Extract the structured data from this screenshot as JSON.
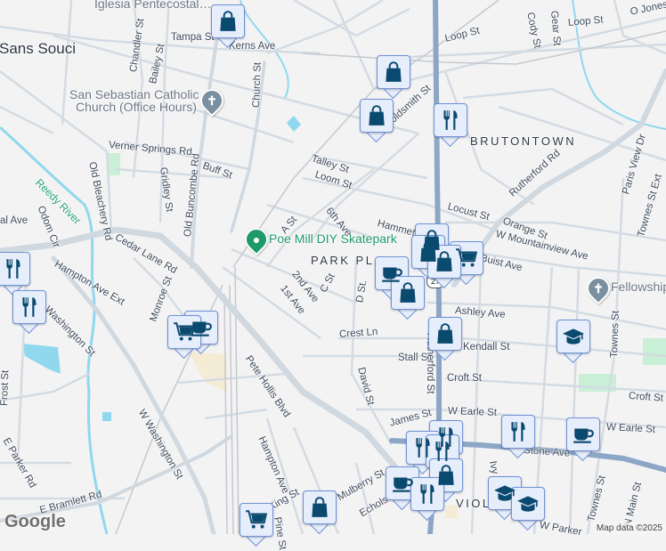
{
  "map": {
    "neighborhoods": [
      "Sans Souci",
      "BRUTONTOWN",
      "PARK PLACE",
      "VIOLA"
    ],
    "places": {
      "church1": "Iglesia Pentecostal…",
      "church2_line1": "San Sebastian Catholic",
      "church2_line2": "Church (Office Hours)",
      "skatepark": "Poe Mill DIY Skatepark",
      "fellowship": "Fellowship",
      "river": "Reedy River"
    },
    "streets": [
      "Tampa St",
      "Kerns Ave",
      "Chandler St",
      "Bailey St",
      "Church St",
      "Verner Springs Rd",
      "Buff St",
      "Old Bleachery Rd",
      "Gridley St",
      "Old Buncombe Rd",
      "Odom Cir",
      "al Ave",
      "Cedar Lane Rd",
      "A St",
      "6th Ave",
      "Talley St",
      "Loom St",
      "Hammett St",
      "2nd Ave",
      "1st Ave",
      "C St",
      "D St.",
      "oldsmith St",
      "Loop St",
      "Loop St",
      "O Jones",
      "Cody St",
      "Rutherford Rd",
      "Paris View Dr",
      "Townes St Ext",
      "Locust St",
      "Orange St",
      "W Mountainview Ave",
      "Buist Ave",
      "Ashley Ave",
      "Crest Ln",
      "Kendall St",
      "Stall St",
      "Rutherford St",
      "Croft St",
      "Croft St",
      "David St",
      "Townes St",
      "James St",
      "W Earle St",
      "W Earle St",
      "Stone Ave",
      "Ivy St",
      "Mulberry St",
      "Echols St",
      "W Parker",
      "Townes St",
      "N Main St",
      "Hampton Ave Ext",
      "Monroe St",
      "Washington St",
      "Frost St",
      "W Washington St",
      "Pete Hollis Blvd",
      "E Parker Rd",
      "Hampton Ave",
      "E Bramlett Rd",
      "King St",
      "Pine St",
      "Gear St"
    ],
    "route_shield": "27",
    "attribution": "Map data ©2025",
    "logo": "Google"
  },
  "colors": {
    "highway": "#8ca6c6",
    "marker_bg": "#e6edfb",
    "marker_border": "#6f92d8",
    "icon": "#0b4a6f",
    "water": "#8fd8ee",
    "park": "#c9efd6"
  }
}
